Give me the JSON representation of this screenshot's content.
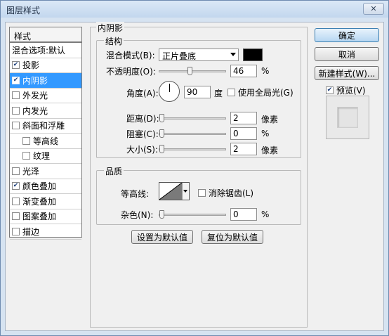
{
  "window": {
    "title": "图层样式",
    "close_glyph": "✕"
  },
  "style_list": {
    "header": "样式",
    "items": [
      {
        "label": "混合选项:默认",
        "checkbox": false,
        "checked": false,
        "indent": false,
        "selected": false
      },
      {
        "label": "投影",
        "checkbox": true,
        "checked": true,
        "indent": false,
        "selected": false
      },
      {
        "label": "内阴影",
        "checkbox": true,
        "checked": true,
        "indent": false,
        "selected": true
      },
      {
        "label": "外发光",
        "checkbox": true,
        "checked": false,
        "indent": false,
        "selected": false
      },
      {
        "label": "内发光",
        "checkbox": true,
        "checked": false,
        "indent": false,
        "selected": false
      },
      {
        "label": "斜面和浮雕",
        "checkbox": true,
        "checked": false,
        "indent": false,
        "selected": false
      },
      {
        "label": "等高线",
        "checkbox": true,
        "checked": false,
        "indent": true,
        "selected": false
      },
      {
        "label": "纹理",
        "checkbox": true,
        "checked": false,
        "indent": true,
        "selected": false
      },
      {
        "label": "光泽",
        "checkbox": true,
        "checked": false,
        "indent": false,
        "selected": false
      },
      {
        "label": "颜色叠加",
        "checkbox": true,
        "checked": true,
        "indent": false,
        "selected": false
      },
      {
        "label": "渐变叠加",
        "checkbox": true,
        "checked": false,
        "indent": false,
        "selected": false
      },
      {
        "label": "图案叠加",
        "checkbox": true,
        "checked": false,
        "indent": false,
        "selected": false
      },
      {
        "label": "描边",
        "checkbox": true,
        "checked": false,
        "indent": false,
        "selected": false
      }
    ]
  },
  "panel": {
    "title": "内阴影",
    "structure": {
      "title": "结构",
      "blend_mode_label": "混合模式(B):",
      "blend_mode_value": "正片叠底",
      "shadow_color": "#000000",
      "opacity_label": "不透明度(O):",
      "opacity_value": "46",
      "opacity_fraction": 0.46,
      "opacity_unit": "%",
      "angle_label": "角度(A):",
      "angle_value": "90",
      "angle_unit": "度",
      "global_light_label": "使用全局光(G)",
      "global_light_checked": false,
      "distance_label": "距离(D):",
      "distance_value": "2",
      "distance_unit": "像素",
      "choke_label": "阻塞(C):",
      "choke_value": "0",
      "choke_unit": "%",
      "size_label": "大小(S):",
      "size_value": "2",
      "size_unit": "像素"
    },
    "quality": {
      "title": "品质",
      "contour_label": "等高线:",
      "antialias_label": "消除锯齿(L)",
      "antialias_checked": false,
      "noise_label": "杂色(N):",
      "noise_value": "0",
      "noise_unit": "%"
    },
    "buttons": {
      "make_default": "设置为默认值",
      "reset_default": "复位为默认值"
    }
  },
  "right": {
    "ok": "确定",
    "cancel": "取消",
    "new_style": "新建样式(W)...",
    "preview_label": "预览(V)",
    "preview_checked": true
  }
}
